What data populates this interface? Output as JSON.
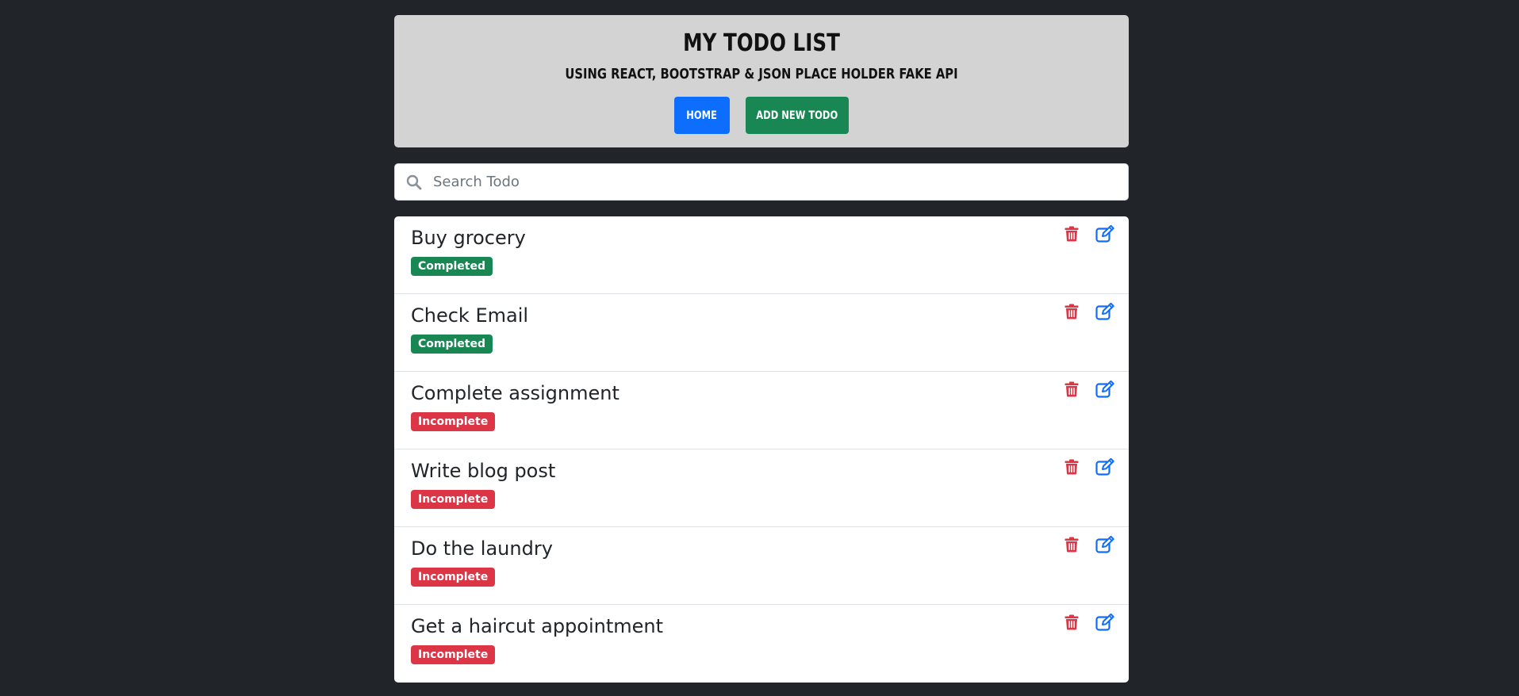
{
  "header": {
    "title": "MY TODO LIST",
    "subtitle": "USING REACT, BOOTSTRAP & JSON PLACE HOLDER FAKE API",
    "home_label": "HOME",
    "add_label": "ADD NEW TODO"
  },
  "search": {
    "placeholder": "Search Todo",
    "icon": "search-icon"
  },
  "todos": [
    {
      "title": "Buy grocery",
      "status": "Completed"
    },
    {
      "title": "Check Email",
      "status": "Completed"
    },
    {
      "title": "Complete assignment",
      "status": "Incomplete"
    },
    {
      "title": "Write blog post",
      "status": "Incomplete"
    },
    {
      "title": "Do the laundry",
      "status": "Incomplete"
    },
    {
      "title": "Get a haircut appointment",
      "status": "Incomplete"
    }
  ],
  "icons": {
    "delete": "trash-icon",
    "edit": "edit-icon"
  },
  "colors": {
    "background": "#212529",
    "header_bg": "#d3d3d3",
    "primary": "#0d6efd",
    "success": "#198754",
    "danger": "#dc3545"
  }
}
